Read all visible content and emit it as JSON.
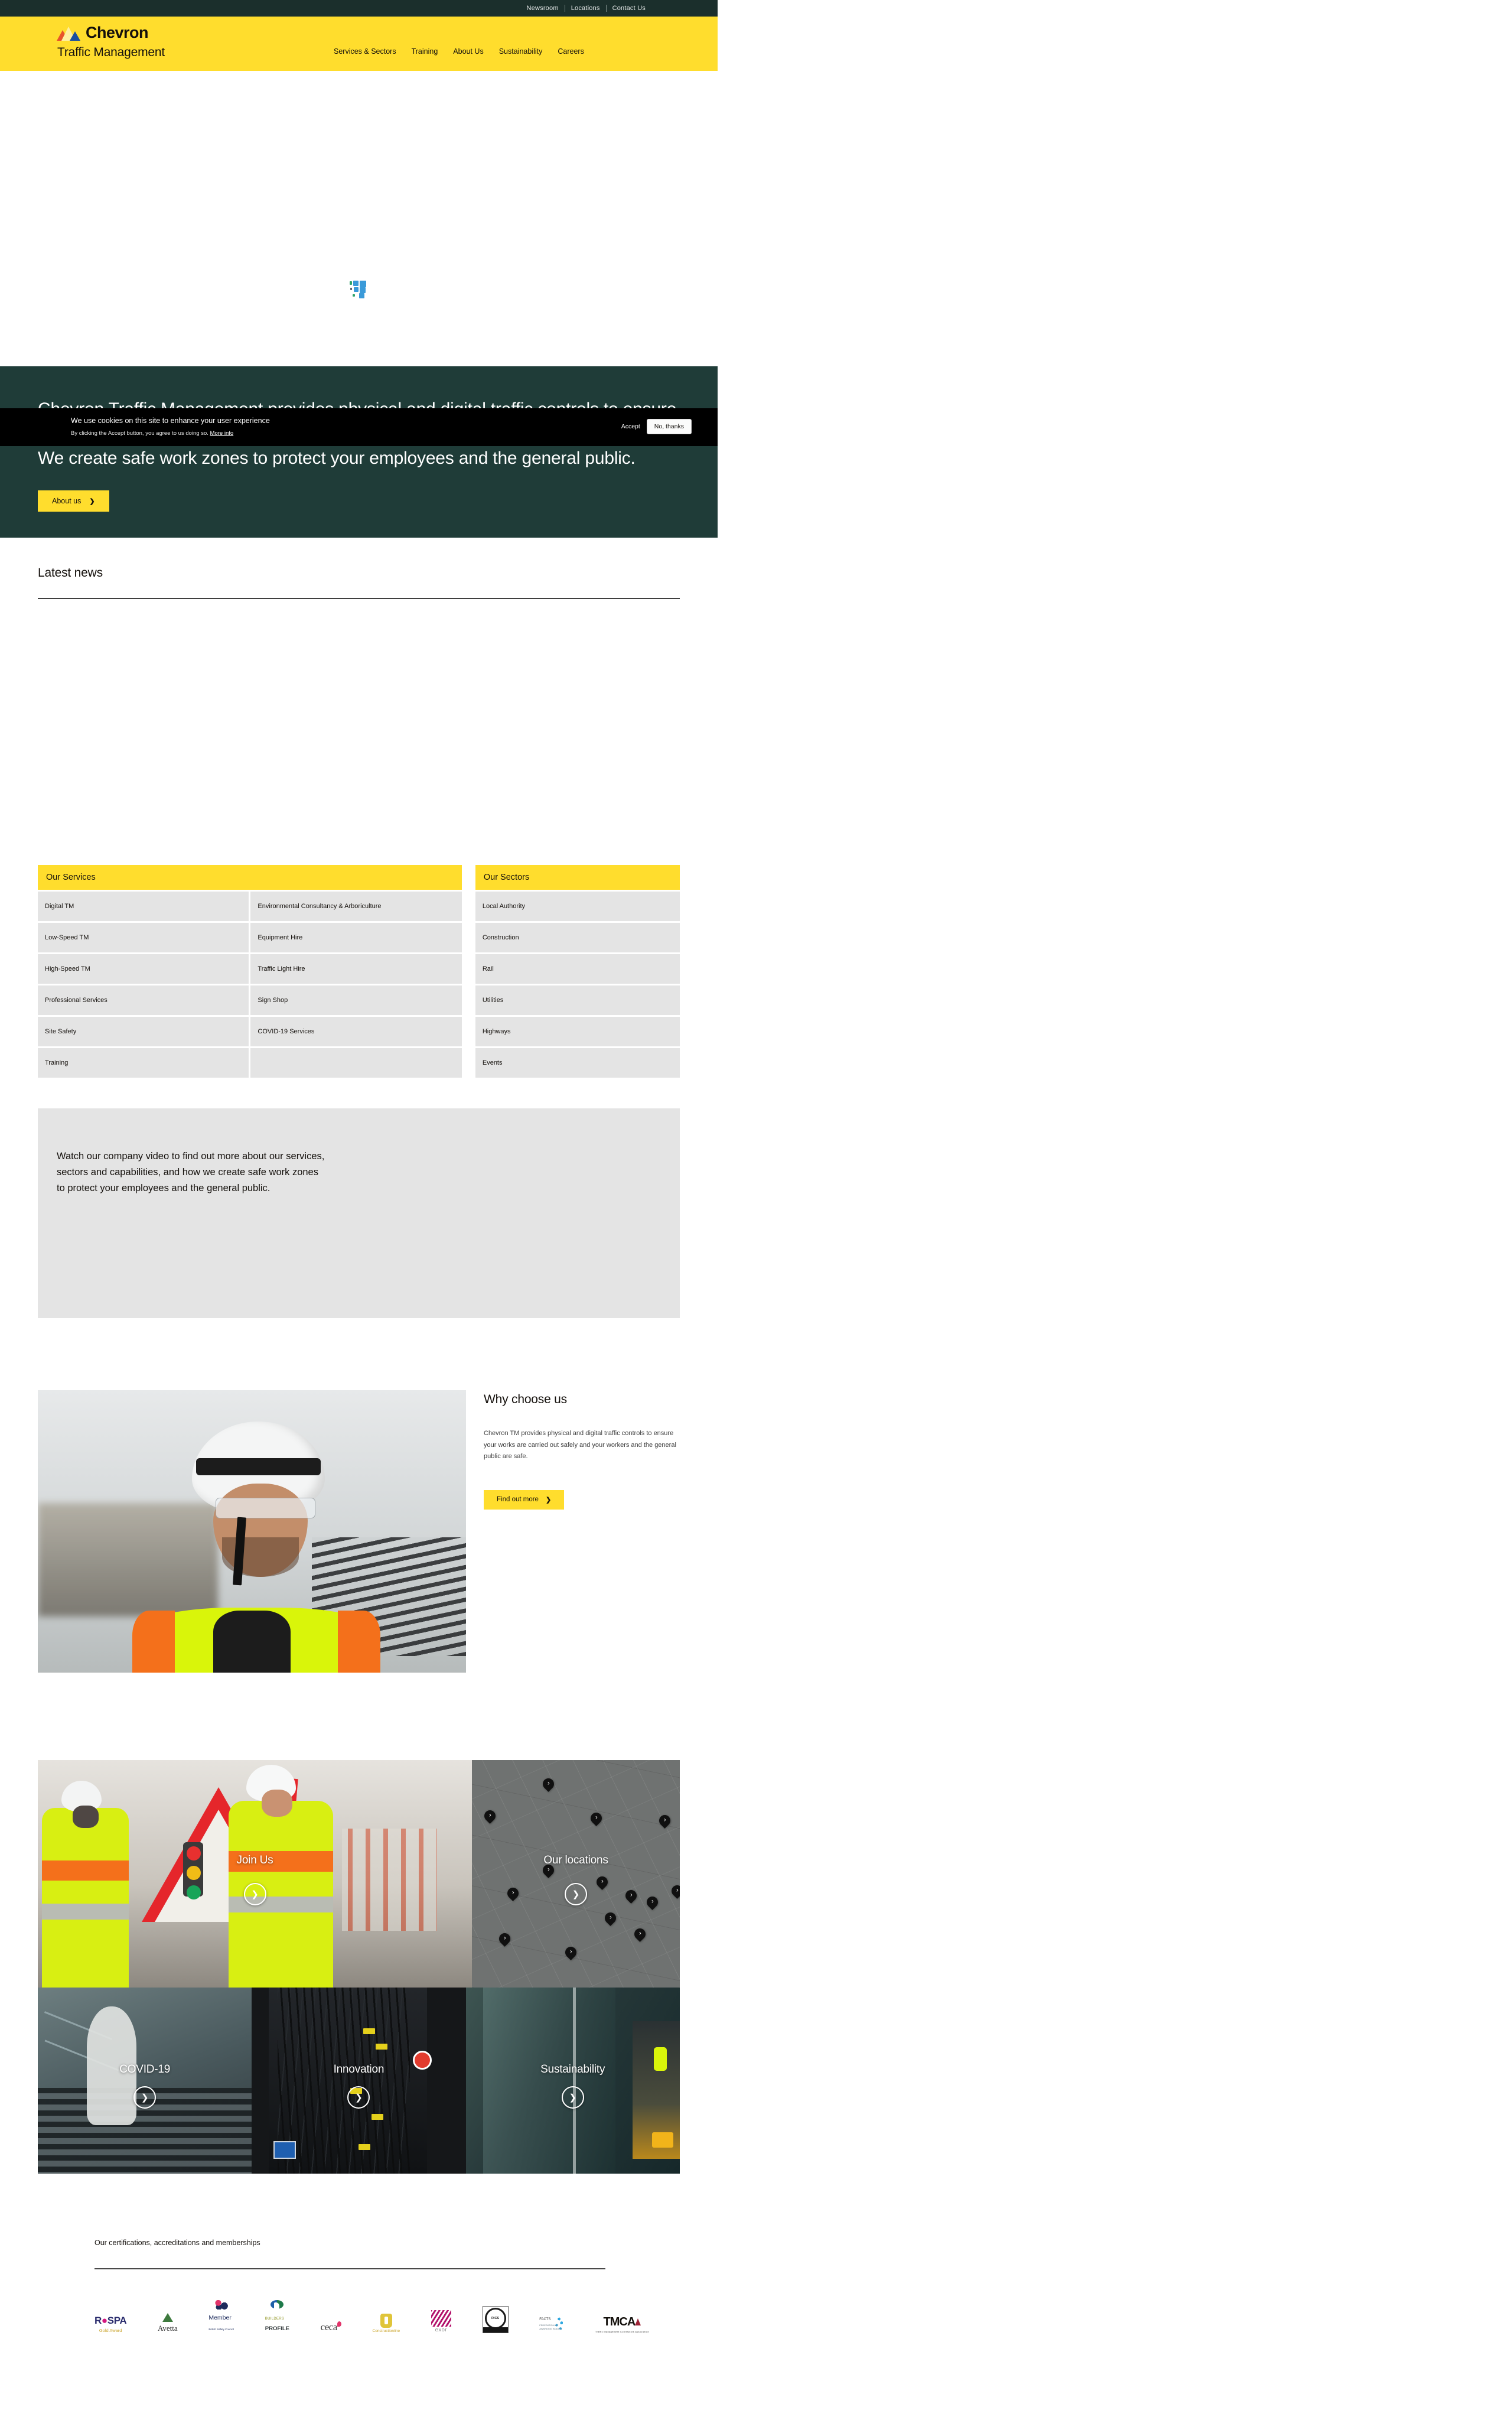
{
  "brand": {
    "name": "Chevron",
    "subtitle": "Traffic Management",
    "logo_icon": "chevron-triangles-logo"
  },
  "utility_nav": {
    "items": [
      {
        "label": "Newsroom"
      },
      {
        "label": "Locations"
      },
      {
        "label": "Contact Us"
      }
    ]
  },
  "main_nav": {
    "items": [
      {
        "label": "Services & Sectors"
      },
      {
        "label": "Training"
      },
      {
        "label": "About Us"
      },
      {
        "label": "Sustainability"
      },
      {
        "label": "Careers"
      }
    ]
  },
  "hero": {
    "media_state": "broken-image-placeholder",
    "heading": "Chevron Traffic Management provides physical and digital traffic controls to ensure your works are carried out safely and your workers and the general public are safe. We create safe work zones to protect your employees and the general public.",
    "cta_label": "About us",
    "cta_icon": "chevron-right-icon"
  },
  "cookie_banner": {
    "title": "We use cookies on this site to enhance your user experience",
    "subtitle_prefix": "By clicking the Accept button, you agree to us doing so.",
    "more_info_label": "More info",
    "accept_label": "Accept",
    "decline_label": "No, thanks"
  },
  "latest_news": {
    "title": "Latest news"
  },
  "services": {
    "header": "Our Services",
    "items": [
      "Digital TM",
      "Environmental Consultancy & Arboriculture",
      "Low-Speed TM",
      "Equipment Hire",
      "High-Speed TM",
      "Traffic Light Hire",
      "Professional Services",
      "Sign Shop",
      "Site Safety",
      "COVID-19 Services",
      "Training",
      ""
    ]
  },
  "sectors": {
    "header": "Our Sectors",
    "items": [
      "Local Authority",
      "Construction",
      "Rail",
      "Utilities",
      "Highways",
      "Events"
    ]
  },
  "video_block": {
    "copy": "Watch our company video to find out more about our services, sectors and capabilities, and how we create safe work zones to protect your employees and the general public."
  },
  "why_choose_us": {
    "title": "Why choose us",
    "body": "Chevron TM provides physical and digital traffic controls to ensure your works are carried out safely and your workers and the general public are safe.",
    "cta_label": "Find out more",
    "cta_icon": "chevron-right-icon",
    "image_alt": "smiling-worker-hardhat-photo"
  },
  "tiles": {
    "row1": [
      {
        "label": "Join Us",
        "icon": "chevron-right-circle-icon",
        "art": "workers-warning-sign-photo"
      },
      {
        "label": "Our locations",
        "icon": "chevron-right-circle-icon",
        "art": "uk-map-with-pins"
      }
    ],
    "row2": [
      {
        "label": "COVID-19",
        "icon": "chevron-right-circle-icon",
        "art": "ppe-suit-photo"
      },
      {
        "label": "Innovation",
        "icon": "chevron-right-circle-icon",
        "art": "control-cabinet-photo"
      },
      {
        "label": "Sustainability",
        "icon": "chevron-right-circle-icon",
        "art": "glass-facade-truck-photo"
      }
    ]
  },
  "certifications": {
    "title": "Our certifications, accreditations and memberships",
    "logos": [
      {
        "name": "RoSPA",
        "sub": "Gold Award"
      },
      {
        "name": "Avetta",
        "sub": ""
      },
      {
        "name": "Member",
        "sub": "British Safety Council"
      },
      {
        "name": "Builders Profile",
        "sub": ""
      },
      {
        "name": "ceca",
        "sub": ""
      },
      {
        "name": "Constructionline",
        "sub": ""
      },
      {
        "name": "exor",
        "sub": ""
      },
      {
        "name": "RICS",
        "sub": ""
      },
      {
        "name": "FACTS",
        "sub": ""
      },
      {
        "name": "TMCA",
        "sub": "Traffic Management Contractors Association"
      }
    ]
  },
  "colors": {
    "brand_yellow": "#ffdd2d",
    "dark_green": "#1b2f2c",
    "hero_green": "#1f3c38",
    "table_grey": "#e4e4e4",
    "text_dark": "#14100c"
  }
}
